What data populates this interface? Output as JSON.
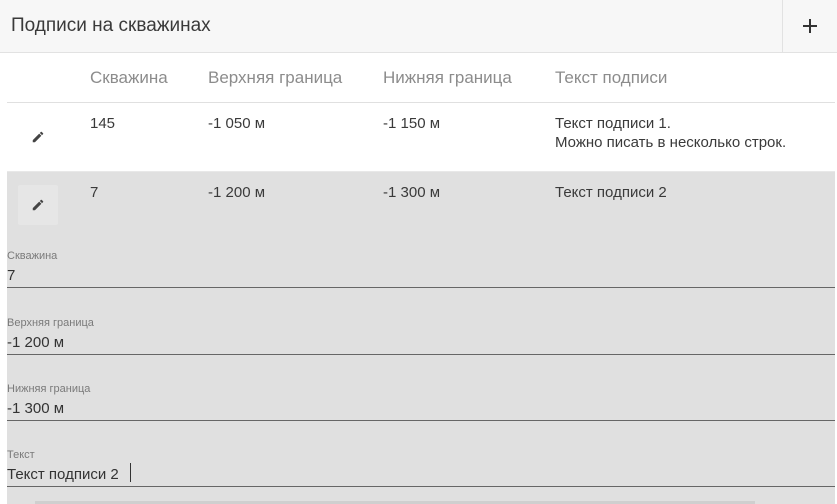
{
  "header": {
    "title": "Подписи на скважинах",
    "add_icon": "plus-icon"
  },
  "table": {
    "columns": [
      "Скважина",
      "Верхняя граница",
      "Нижняя граница",
      "Текст подписи"
    ],
    "rows": [
      {
        "well": "145",
        "top": "-1 050 м",
        "bottom": "-1 150 м",
        "text_line1": "Текст подписи 1.",
        "text_line2": "Можно писать в несколько строк.",
        "edit_icon": "pencil-icon"
      },
      {
        "well": "7",
        "top": "-1 200 м",
        "bottom": "-1 300 м",
        "text_line1": "Текст подписи 2",
        "edit_icon": "pencil-icon",
        "selected": true
      }
    ]
  },
  "edit_form": {
    "well_label": "Скважина",
    "well_value": "7",
    "top_label": "Верхняя граница",
    "top_value": "-1 200 м",
    "bottom_label": "Нижняя граница",
    "bottom_value": "-1 300 м",
    "text_label": "Текст",
    "text_value": "Текст подписи 2"
  },
  "colors": {
    "selected_row_bg": "#e0e0e0",
    "header_bg": "#f7f7f7",
    "column_header_text": "#8c8c8c"
  }
}
